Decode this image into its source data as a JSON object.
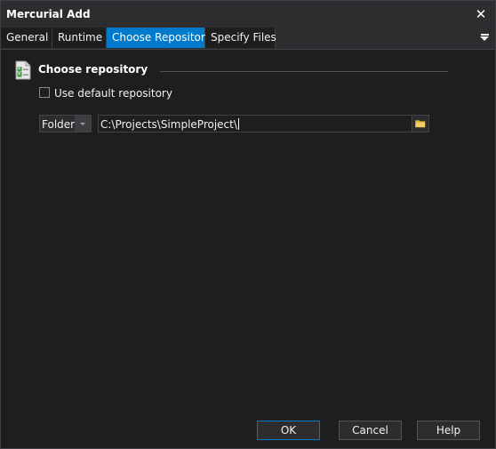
{
  "window": {
    "title": "Mercurial Add"
  },
  "tabs": [
    {
      "label": "General"
    },
    {
      "label": "Runtime"
    },
    {
      "label": "Choose Repository"
    },
    {
      "label": "Specify Files"
    }
  ],
  "active_tab": "Choose Repository",
  "section": {
    "title": "Choose repository"
  },
  "use_default": {
    "label": "Use default repository",
    "checked": false
  },
  "repo_type": {
    "value": "Folder"
  },
  "repo_path": {
    "value": "C:\\Projects\\SimpleProject\\"
  },
  "buttons": {
    "ok": "OK",
    "cancel": "Cancel",
    "help": "Help"
  },
  "colors": {
    "accent": "#007acc",
    "background": "#1e1e1e",
    "chrome": "#2d2d30"
  },
  "icons": [
    "close-icon",
    "tab-menu-icon",
    "checklist-icon",
    "dropdown-arrow-icon",
    "folder-icon"
  ]
}
